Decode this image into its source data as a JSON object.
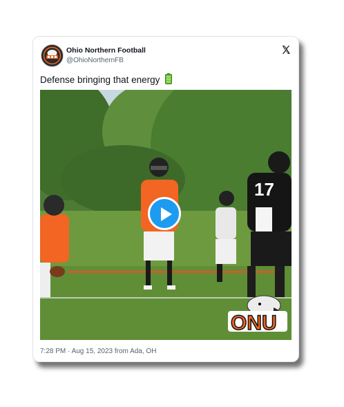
{
  "tweet": {
    "author_name": "Ohio Northern Football",
    "author_handle": "@OhioNorthernFB",
    "text": "Defense bringing that energy",
    "text_emoji": "battery-icon",
    "timestamp": "7:28 PM · Aug 15, 2023 from Ada, OH"
  },
  "media": {
    "jersey_number": "17",
    "logo_text": "ONU",
    "player_icon": "play-icon"
  },
  "colors": {
    "accent": "#1d9bf0",
    "onu_orange": "#f26522",
    "text_primary": "#0f1419",
    "text_secondary": "#536471"
  }
}
